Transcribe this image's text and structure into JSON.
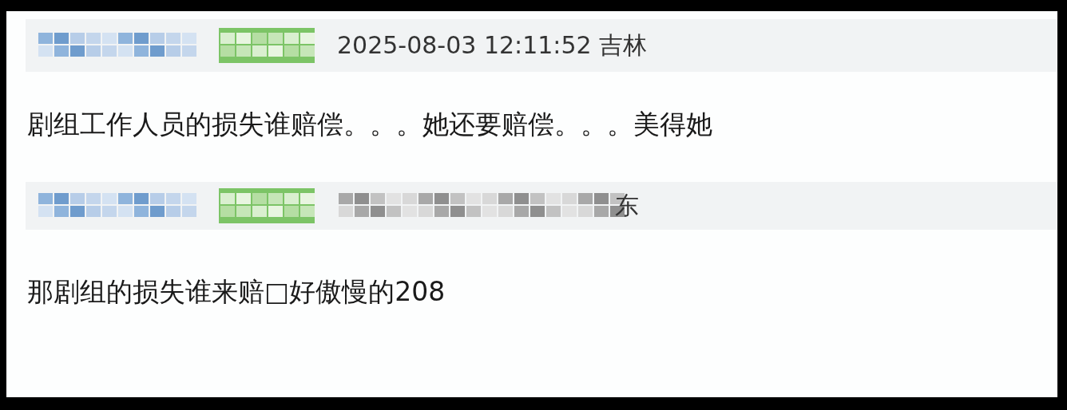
{
  "comments": [
    {
      "header": [
        {
          "kind": "blurred-name"
        },
        {
          "kind": "blurred-badge"
        },
        {
          "kind": "text",
          "text": "2025-08-03 12:11:52 吉林"
        }
      ],
      "body": "剧组工作人员的损失谁赔偿。。。她还要赔偿。。。美得她"
    },
    {
      "header": [
        {
          "kind": "blurred-name"
        },
        {
          "kind": "blurred-badge"
        },
        {
          "kind": "blurred-date"
        },
        {
          "kind": "text",
          "text": "东"
        }
      ],
      "body": "那剧组的损失谁来赔□好傲慢的208"
    }
  ]
}
